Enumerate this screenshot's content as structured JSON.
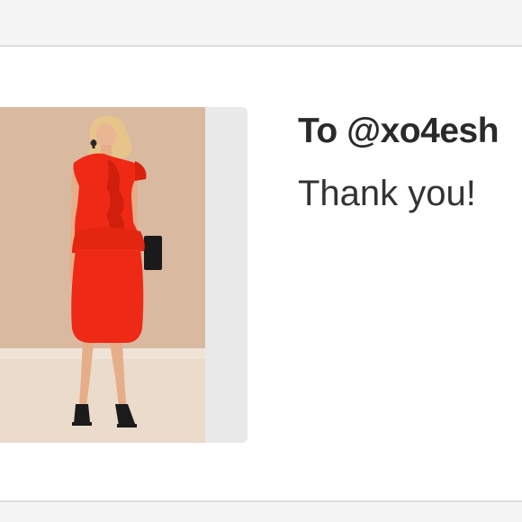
{
  "message": {
    "recipient": "To @xo4esh",
    "body": "Thank you!"
  },
  "product": {
    "image_subject": "model-in-red-one-shoulder-ruffle-dress",
    "dress_color": "#ee2a16",
    "background_color": "#d8b9a0"
  }
}
